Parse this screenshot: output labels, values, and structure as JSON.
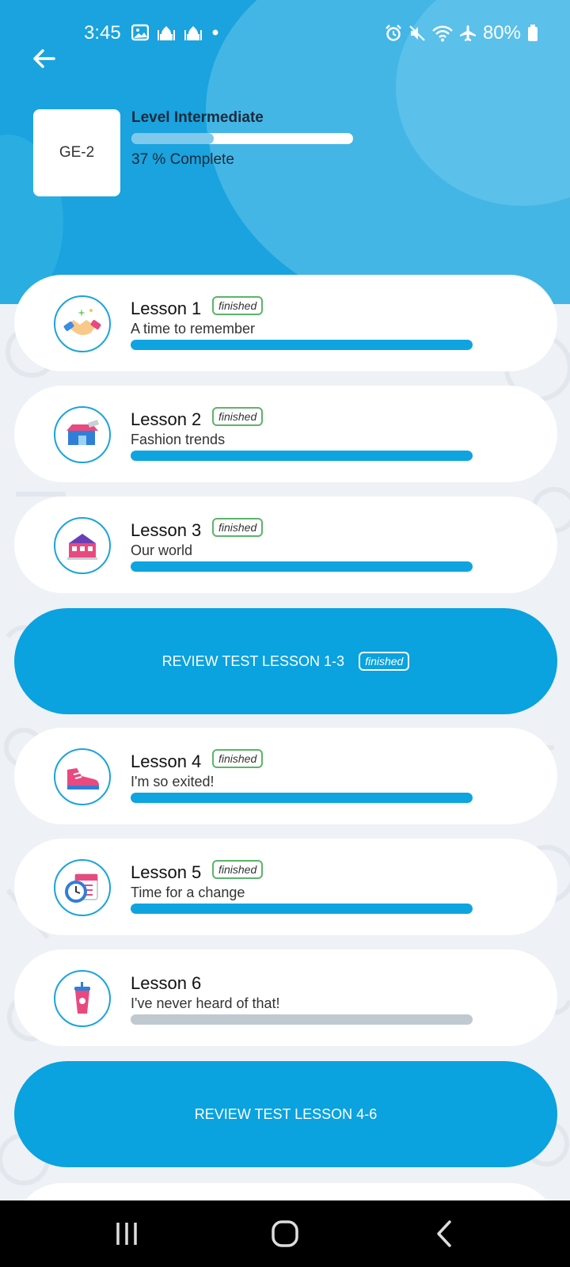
{
  "status_bar": {
    "time": "3:45",
    "battery": "80%"
  },
  "header": {
    "level_code": "GE-2",
    "level_title": "Level Intermediate",
    "progress_percent": 37,
    "progress_text": "37 % Complete"
  },
  "lessons": [
    {
      "title": "Lesson 1",
      "subtitle": "A time to remember",
      "badge": "finished",
      "progress": 1.0,
      "icon": "handshake-icon"
    },
    {
      "title": "Lesson 2",
      "subtitle": "Fashion trends",
      "badge": "finished",
      "progress": 1.0,
      "icon": "store-icon"
    },
    {
      "title": "Lesson 3",
      "subtitle": "Our world",
      "badge": "finished",
      "progress": 1.0,
      "icon": "building-icon"
    },
    {
      "title": "Lesson 4",
      "subtitle": "I'm so exited!",
      "badge": "finished",
      "progress": 1.0,
      "icon": "sneaker-icon"
    },
    {
      "title": "Lesson 5",
      "subtitle": "Time for a change",
      "badge": "finished",
      "progress": 1.0,
      "icon": "calendar-clock-icon"
    },
    {
      "title": "Lesson 6",
      "subtitle": "I've never heard of that!",
      "badge": "",
      "progress": 0.0,
      "icon": "cup-icon"
    }
  ],
  "reviews": [
    {
      "label": "REVIEW TEST LESSON 1-3",
      "badge": "finished"
    },
    {
      "label": "REVIEW TEST LESSON 4-6",
      "badge": ""
    }
  ],
  "colors": {
    "header_bg": "#1aa3de",
    "accent": "#0aa2df",
    "finished_badge_border": "#5bb56a",
    "bar_empty": "#c0c9cf"
  }
}
